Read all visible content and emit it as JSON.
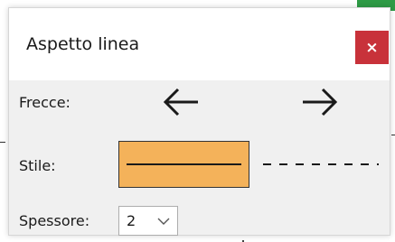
{
  "dialog": {
    "title": "Aspetto linea",
    "close_label": "×"
  },
  "arrows": {
    "label": "Frecce:",
    "left_icon": "arrow-left-icon",
    "right_icon": "arrow-right-icon"
  },
  "style": {
    "label": "Stile:",
    "options": [
      "solid",
      "dashed"
    ],
    "selected": "solid",
    "selected_color": "#f4b25a"
  },
  "thickness": {
    "label": "Spessore:",
    "value": "2"
  },
  "colors": {
    "close_button": "#c8323a",
    "dialog_background": "#f0f0f0"
  }
}
